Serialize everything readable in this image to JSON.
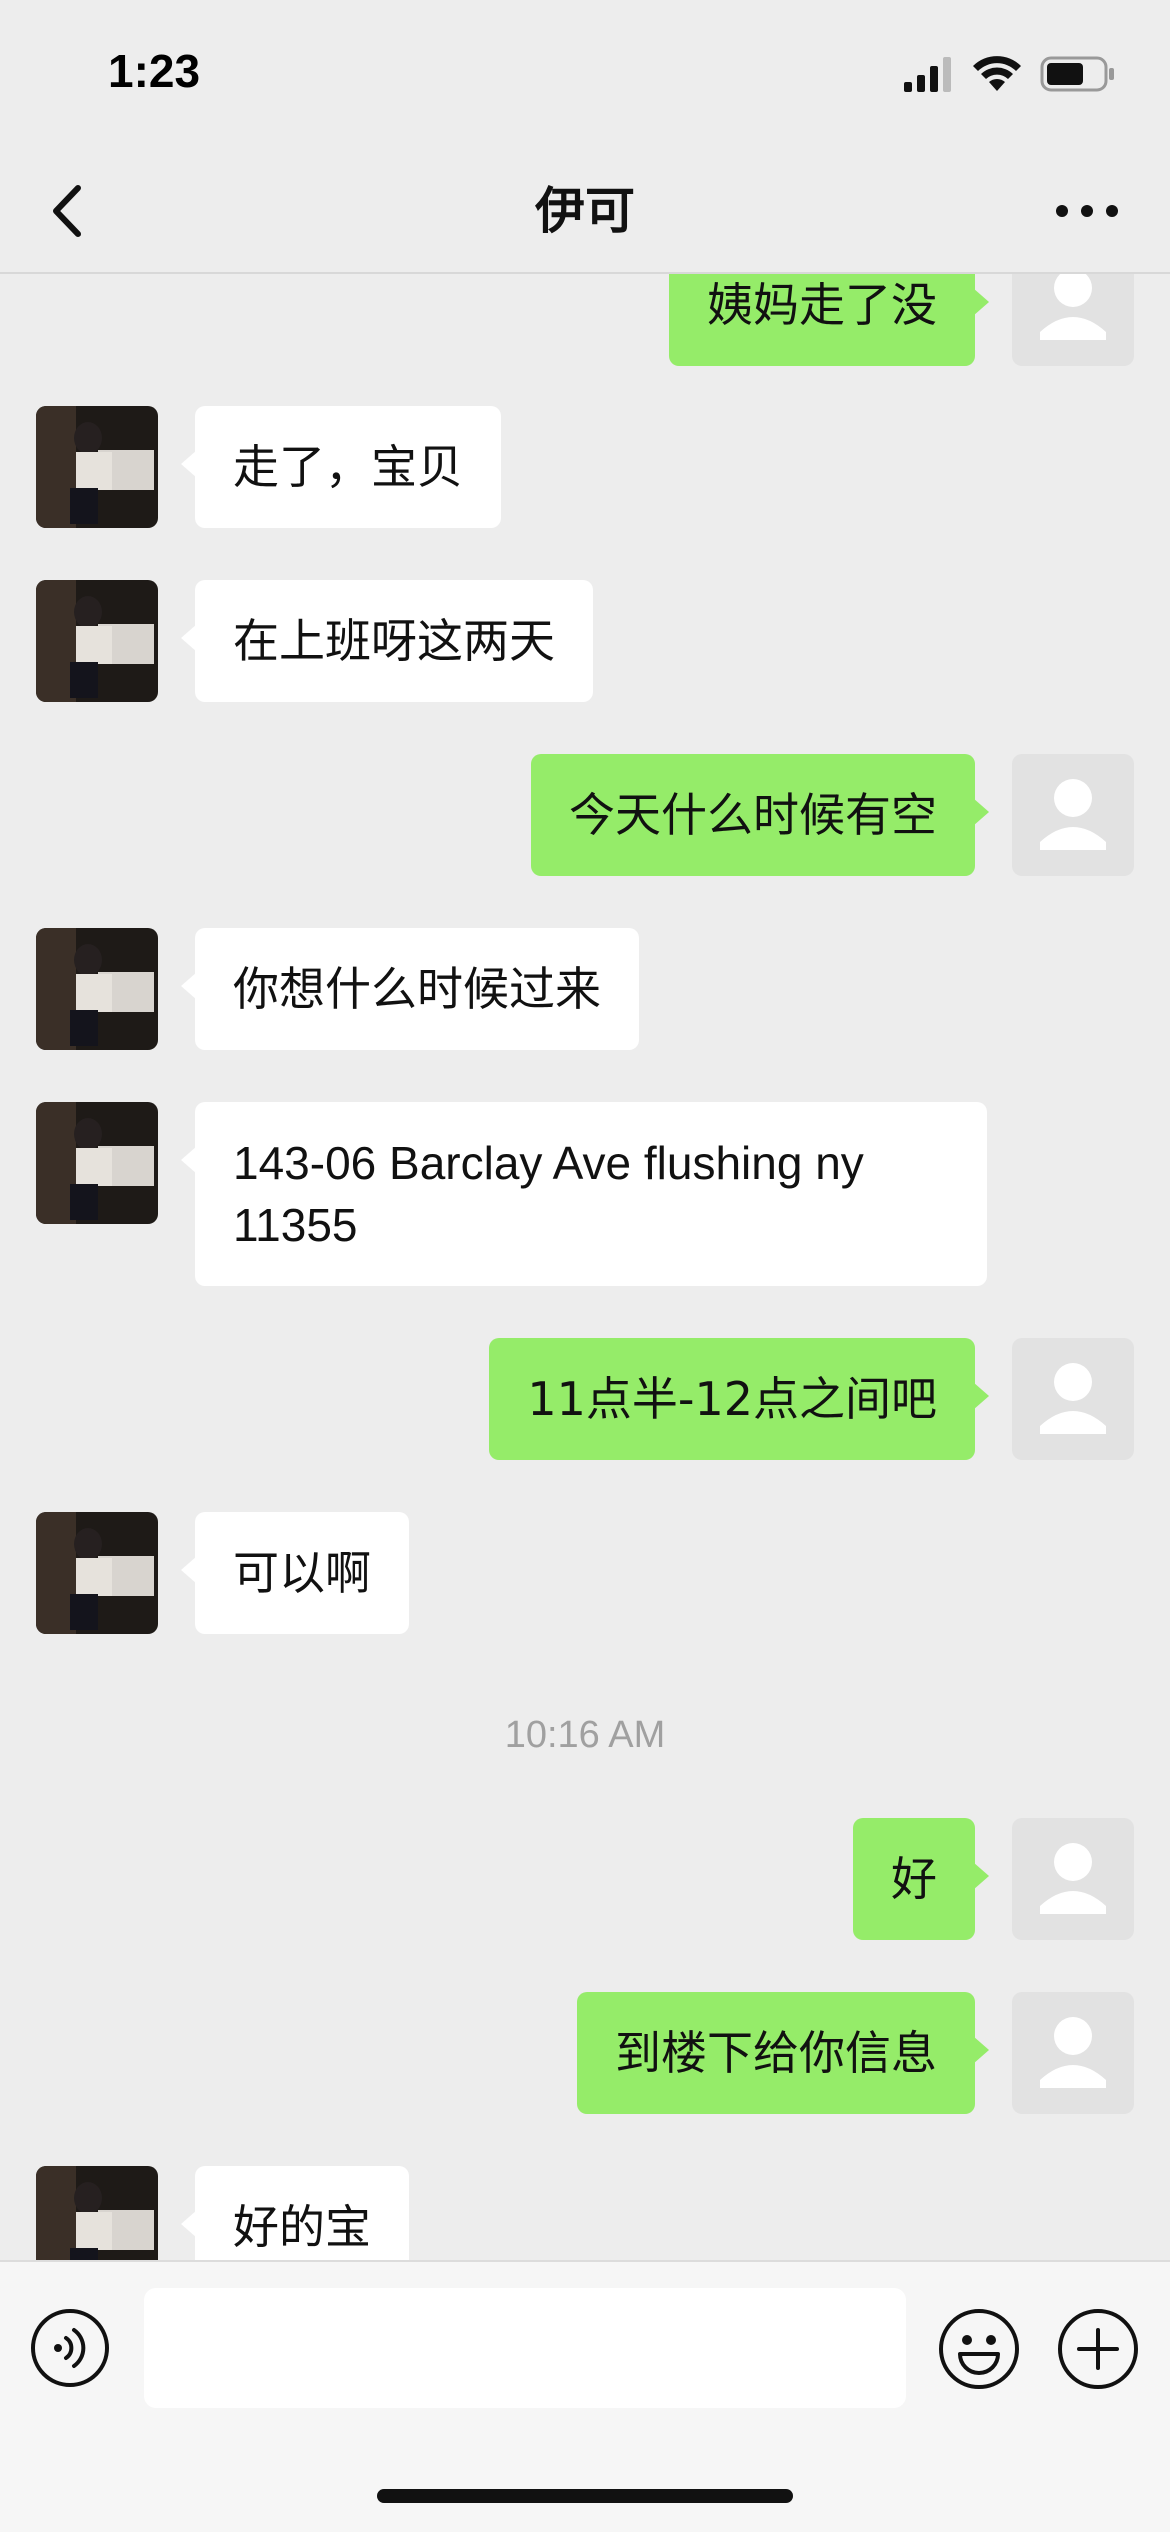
{
  "status_bar": {
    "time": "1:23",
    "icons": [
      "cellular-signal-icon",
      "wifi-icon",
      "battery-icon"
    ]
  },
  "header": {
    "back_icon": "chevron-left-icon",
    "title": "伊可",
    "more_icon": "ellipsis-icon"
  },
  "colors": {
    "background": "#ededed",
    "sent_bubble": "#95ec69",
    "received_bubble": "#ffffff",
    "timestamp": "#a0a0a0"
  },
  "messages": [
    {
      "side": "right",
      "text": "姨妈走了没"
    },
    {
      "side": "left",
      "text": "走了，宝贝"
    },
    {
      "side": "left",
      "text": "在上班呀这两天"
    },
    {
      "side": "right",
      "text": "今天什么时候有空"
    },
    {
      "side": "left",
      "text": "你想什么时候过来"
    },
    {
      "side": "left",
      "text": "143-06 Barclay Ave flushing ny 11355"
    },
    {
      "side": "right",
      "text": "11点半-12点之间吧"
    },
    {
      "side": "left",
      "text": "可以啊"
    },
    {
      "side": "right",
      "text": "好"
    },
    {
      "side": "right",
      "text": "到楼下给你信息"
    },
    {
      "side": "left",
      "text": "好的宝"
    }
  ],
  "timestamp": "10:16 AM",
  "input_bar": {
    "voice_icon": "voice-icon",
    "text_value": "",
    "emoji_icon": "smiley-icon",
    "plus_icon": "plus-circle-icon"
  }
}
